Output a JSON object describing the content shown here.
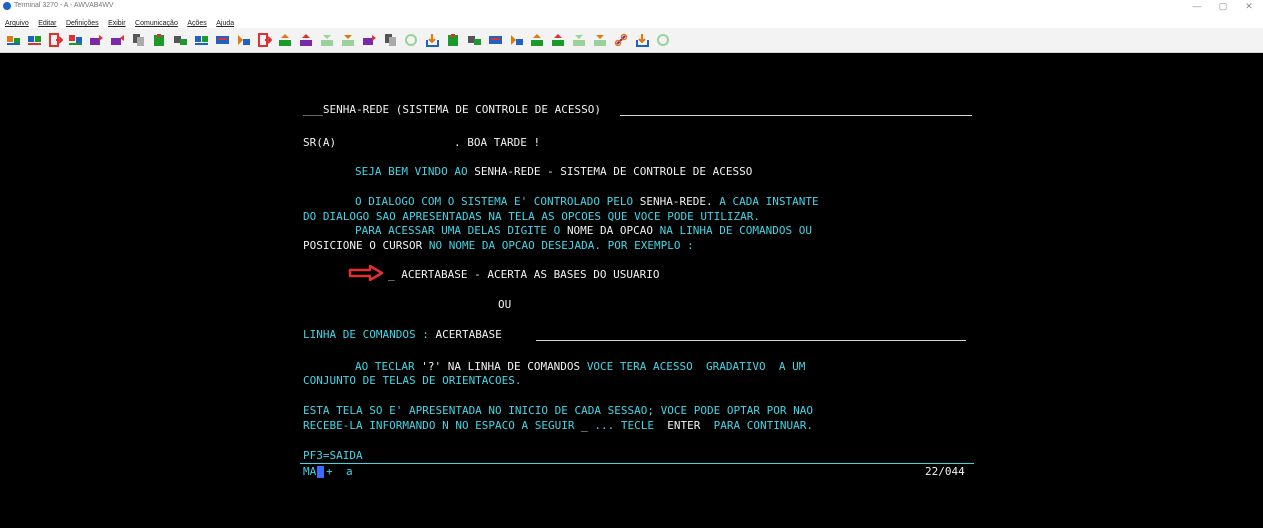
{
  "window": {
    "title": "Terminal 3270 - A - AWVAB4WV",
    "controls": [
      "—",
      "▢",
      "✕"
    ]
  },
  "menu": [
    "Arquivo",
    "Editar",
    "Definições",
    "Exibir",
    "Comunicação",
    "Ações",
    "Ajuda"
  ],
  "toolbar": {
    "icons": [
      "connect-icon",
      "disconnect-icon",
      "exit-icon",
      "session-icon",
      "send-icon",
      "receive-icon",
      "copy-icon",
      "paste-icon",
      "print-icon",
      "macro-icon",
      "keyboard-icon",
      "clear-icon",
      "exit2-icon",
      "upload-icon",
      "upload2-icon",
      "download-icon",
      "download2-icon",
      "transfer-icon",
      "copy2-icon",
      "refresh-icon",
      "save-icon",
      "paste2-icon",
      "link-icon",
      "keyboard2-icon",
      "clear2-icon",
      "tool-icon",
      "tool2-icon",
      "tool3-icon",
      "tool4-icon",
      "link2-icon",
      "save2-icon",
      "refresh2-icon"
    ],
    "colors": {
      "red": "#e03030",
      "green": "#1a9a2a",
      "blue": "#1e63c4",
      "orange": "#e07a10",
      "purple": "#7a2aa8"
    }
  },
  "screen": {
    "header": "___SENHA-REDE (SISTEMA DE CONTROLE DE ACESSO)",
    "greeting_prefix": "SR(A)",
    "greeting_suffix": ". BOA TARDE !",
    "welcome_a": "SEJA BEM VINDO AO",
    "welcome_b": "SENHA-REDE - SISTEMA DE CONTROLE DE ACESSO",
    "p1_a": "O DIALOGO COM O SISTEMA E' CONTROLADO PELO",
    "p1_b": "SENHA-REDE.",
    "p1_c": "A CADA INSTANTE",
    "p2": "DO DIALOGO SAO APRESENTADAS NA TELA AS OPCOES QUE VOCE PODE UTILIZAR.",
    "p3_a": "PARA ACESSAR UMA DELAS DIGITE O",
    "p3_b": "NOME DA OPCAO",
    "p3_c": "NA LINHA DE COMANDOS OU",
    "p4_a": "POSICIONE O CURSOR",
    "p4_b": "NO NOME DA OPCAO DESEJADA. POR EXEMPLO :",
    "example": "_ ACERTABASE - ACERTA AS BASES DO USUARIO",
    "ou": "OU",
    "cmd_label": "LINHA DE COMANDOS :",
    "cmd_value": "ACERTABASE",
    "p5_a": "AO TECLAR",
    "p5_b": "'?' NA LINHA DE COMANDOS",
    "p5_c": "VOCE TERA ACESSO  GRADATIVO  A UM",
    "p6": "CONJUNTO DE TELAS DE ORIENTACOES.",
    "p7": "ESTA TELA SO E' APRESENTADA NO INICIO DE CADA SESSAO; VOCE PODE OPTAR POR NAO",
    "p8_a": "RECEBE-LA INFORMANDO N NO ESPACO A SEGUIR",
    "p8_field": "_",
    "p8_b": "... TECLE",
    "p8_c": "ENTER",
    "p8_d": "PARA CONTINUAR.",
    "pf3": "PF3=SAIDA",
    "status_left": "MA",
    "status_plus": "+",
    "status_a": "a",
    "status_right": "22/044"
  },
  "colors": {
    "cyan": "#3fd7e8",
    "white": "#f2f2f2",
    "arrow": "#e03030",
    "cursor": "#3d6bff"
  }
}
